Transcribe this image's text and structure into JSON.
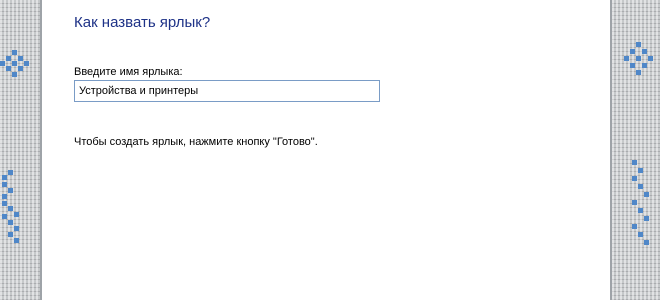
{
  "dialog": {
    "heading": "Как назвать ярлык?",
    "name_label": "Введите имя ярлыка:",
    "name_value": "Устройства и принтеры",
    "hint": "Чтобы создать ярлык, нажмите кнопку \"Готово\"."
  },
  "colors": {
    "heading": "#1e3287",
    "input_border": "#7a9cc6",
    "knit_background": "#c9cccf",
    "knit_motif": "#4f87c8"
  },
  "decor": {
    "left_motif_icons": [
      "snowflake-icon",
      "deer-icon"
    ],
    "right_motif_icons": [
      "snowflake-icon",
      "deer-icon"
    ]
  }
}
